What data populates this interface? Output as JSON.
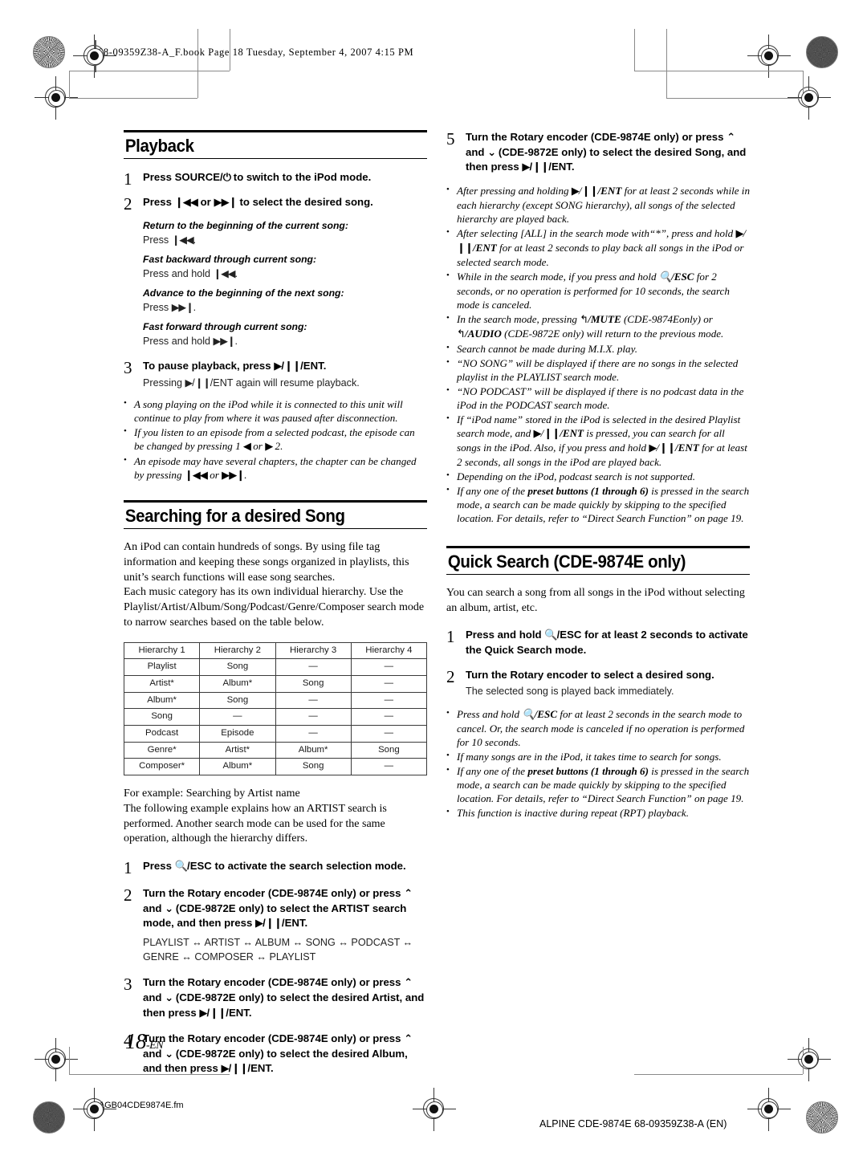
{
  "header": {
    "file_line": "68-09359Z38-A_F.book   Page 18   Tuesday, September 4, 2007   4:15 PM"
  },
  "footer": {
    "folio_number": "18",
    "folio_suffix": "-EN",
    "source_file": "1GB04CDE9874E.fm",
    "imprint": "ALPINE CDE-9874E 68-09359Z38-A (EN)"
  },
  "left_column": {
    "playback": {
      "heading": "Playback",
      "steps": [
        {
          "num": "1",
          "head": "Press SOURCE/⏻ to switch to the iPod mode."
        },
        {
          "num": "2",
          "head": "Press ❘◀◀ or ▶▶❘ to select the desired song."
        }
      ],
      "operations": [
        {
          "title": "Return to the beginning of the current song:",
          "text": "Press ❘◀◀."
        },
        {
          "title": "Fast backward through current song:",
          "text": "Press and hold ❘◀◀."
        },
        {
          "title": "Advance to the beginning of the next song:",
          "text": "Press ▶▶❘."
        },
        {
          "title": "Fast forward through current song:",
          "text": "Press and hold ▶▶❘."
        }
      ],
      "step3": {
        "num": "3",
        "head": "To pause playback, press ▶/❙❙/ENT.",
        "sub": "Pressing ▶/❙❙/ENT again will resume playback."
      },
      "notes": [
        "A song playing on the iPod while it is connected to this unit will continue to play from where it was paused after disconnection.",
        "If you listen to an episode from a selected podcast, the episode can be changed by pressing 1 ◀ or ▶ 2.",
        "An episode may have several chapters, the chapter can be changed by pressing ❘◀◀ or ▶▶❘."
      ]
    },
    "searching": {
      "heading": "Searching for a desired Song",
      "intro1": "An iPod can contain hundreds of songs. By using file tag information and keeping these songs organized in playlists, this unit’s search functions will ease song searches.",
      "intro2": "Each music category has its own individual hierarchy. Use the Playlist/Artist/Album/Song/Podcast/Genre/Composer search mode to narrow searches based on the table below.",
      "table": {
        "headers": [
          "Hierarchy 1",
          "Hierarchy 2",
          "Hierarchy 3",
          "Hierarchy 4"
        ],
        "rows": [
          [
            "Playlist",
            "Song",
            "—",
            "—"
          ],
          [
            "Artist*",
            "Album*",
            "Song",
            "—"
          ],
          [
            "Album*",
            "Song",
            "—",
            "—"
          ],
          [
            "Song",
            "—",
            "—",
            "—"
          ],
          [
            "Podcast",
            "Episode",
            "—",
            "—"
          ],
          [
            "Genre*",
            "Artist*",
            "Album*",
            "Song"
          ],
          [
            "Composer*",
            "Album*",
            "Song",
            "—"
          ]
        ]
      },
      "example_line1": "For example: Searching by Artist name",
      "example_line2": "The following example explains how an ARTIST search is performed. Another search mode can be used for the same operation, although the hierarchy differs.",
      "steps": [
        {
          "num": "1",
          "head": "Press 🔍/ESC to activate the search selection mode."
        },
        {
          "num": "2",
          "head": "Turn the Rotary encoder (CDE-9874E only) or press ∧ and ∨ (CDE-9872E only) to select the ARTIST search mode, and then press ▶/❙❙/ENT.",
          "chain": "PLAYLIST ↔ ARTIST ↔ ALBUM ↔ SONG ↔ PODCAST ↔ GENRE ↔ COMPOSER ↔ PLAYLIST"
        },
        {
          "num": "3",
          "head": "Turn the Rotary encoder (CDE-9874E only) or press ∧ and ∨ (CDE-9872E only) to select the desired Artist, and then press ▶/❙❙/ENT."
        },
        {
          "num": "4",
          "head": "Turn the Rotary encoder (CDE-9874E only) or press ∧ and ∨ (CDE-9872E only) to select the desired Album, and then press ▶/❙❙/ENT."
        }
      ]
    }
  },
  "right_column": {
    "step5": {
      "num": "5",
      "head": "Turn the Rotary encoder (CDE-9874E only) or press ∧ and ∨ (CDE-9872E only) to select the desired Song, and then press ▶/❙❙/ENT."
    },
    "notes": [
      "After pressing and holding ▶/❙❙/ENT for at least 2 seconds while in each hierarchy (except SONG hierarchy), all songs of the selected hierarchy are played back.",
      "After selecting [ALL] in the search mode with“*”, press and hold ▶/❙❙/ENT for at least 2 seconds to play back all songs in the iPod or selected search mode.",
      "While in the search mode, if you press and hold 🔍/ESC for 2 seconds, or no operation is performed for 10 seconds, the search mode is canceled.",
      "In the search mode, pressing ↶/MUTE (CDE-9874Eonly) or ↶/AUDIO (CDE-9872E only) will return to the previous mode.",
      "Search cannot be made during M.I.X. play.",
      "“NO SONG” will be displayed if there are no songs in the selected playlist in the PLAYLIST search mode.",
      "“NO PODCAST” will be displayed if there is no podcast data in the iPod in the PODCAST search mode.",
      "If “iPod name” stored in the iPod is selected in the desired Playlist search mode, and ▶/❙❙/ENT is pressed, you can search for all songs in the iPod. Also, if you press and hold ▶/❙❙/ENT for at least 2 seconds, all songs in the iPod are played back.",
      "Depending on the iPod, podcast search is not supported.",
      "If any one of the preset buttons (1 through 6) is pressed in the search mode, a search can be made quickly by skipping to the specified location. For details, refer to “Direct Search Function” on page 19."
    ],
    "quick_search": {
      "heading": "Quick Search (CDE-9874E only)",
      "intro": "You can search a song from all songs in the iPod without selecting an album, artist, etc.",
      "steps": [
        {
          "num": "1",
          "head": "Press and hold 🔍/ESC for at least 2 seconds to activate the Quick Search mode."
        },
        {
          "num": "2",
          "head": "Turn the Rotary encoder to select a desired song.",
          "sub": "The selected song is played back immediately."
        }
      ],
      "notes": [
        "Press and hold 🔍/ESC for at least 2 seconds in the search mode to cancel. Or, the search mode is canceled if no operation is performed for 10 seconds.",
        "If many songs are in the iPod, it takes time to search for songs.",
        "If any one of the preset buttons (1 through 6) is pressed in the search mode, a search can be made quickly by skipping to the specified location. For details, refer to “Direct Search Function” on page 19.",
        "This function is inactive during repeat (RPT) playback."
      ]
    }
  }
}
